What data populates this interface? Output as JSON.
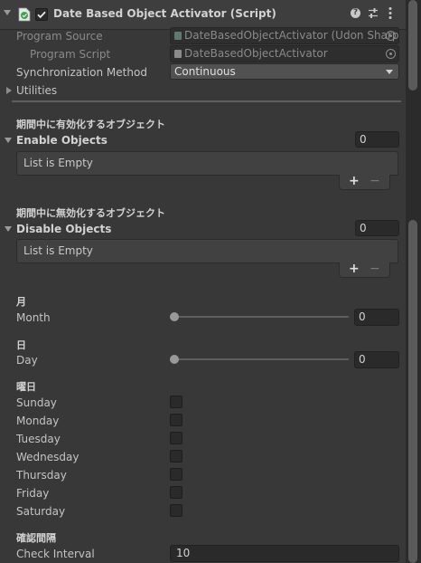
{
  "component": {
    "title": "Date Based Object Activator (Script)",
    "enabled": true,
    "header_icons": [
      "help-icon",
      "presets-icon",
      "more-icon"
    ]
  },
  "script_info": {
    "program_source_label": "Program Source",
    "program_source_value": "DateBasedObjectActivator (Udon Sharp",
    "program_script_label": "Program Script",
    "program_script_value": "DateBasedObjectActivator",
    "sync_label": "Synchronization Method",
    "sync_value": "Continuous",
    "utilities_label": "Utilities"
  },
  "enable_section": {
    "header": "期間中に有効化するオブジェクト",
    "label": "Enable Objects",
    "size": "0",
    "empty_text": "List is Empty",
    "add_label": "+",
    "remove_label": "−"
  },
  "disable_section": {
    "header": "期間中に無効化するオブジェクト",
    "label": "Disable Objects",
    "size": "0",
    "empty_text": "List is Empty",
    "add_label": "+",
    "remove_label": "−"
  },
  "month": {
    "header": "月",
    "label": "Month",
    "value": "0",
    "slider_fraction": 0
  },
  "day": {
    "header": "日",
    "label": "Day",
    "value": "0",
    "slider_fraction": 0
  },
  "weekday": {
    "header": "曜日",
    "days": [
      {
        "label": "Sunday",
        "checked": false
      },
      {
        "label": "Monday",
        "checked": false
      },
      {
        "label": "Tuesday",
        "checked": false
      },
      {
        "label": "Wednesday",
        "checked": false
      },
      {
        "label": "Thursday",
        "checked": false
      },
      {
        "label": "Friday",
        "checked": false
      },
      {
        "label": "Saturday",
        "checked": false
      }
    ]
  },
  "interval": {
    "header": "確認間隔",
    "label": "Check Interval",
    "value": "10"
  },
  "colors": {
    "background": "#383838",
    "field": "#2a2a2a",
    "header_bar": "#3e3e3e",
    "text": "#c4c4c4"
  }
}
